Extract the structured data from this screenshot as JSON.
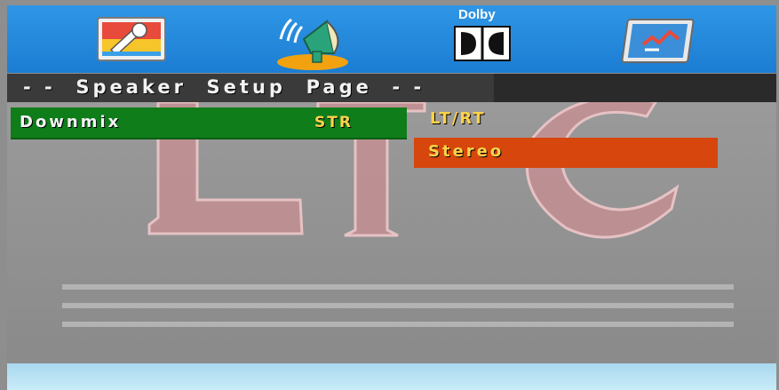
{
  "toolbar": {
    "icons": [
      {
        "name": "general-setup-icon"
      },
      {
        "name": "speaker-setup-icon"
      },
      {
        "name": "dolby-setup-icon",
        "label": "Dolby"
      },
      {
        "name": "preference-setup-icon"
      }
    ]
  },
  "page": {
    "title": "- -  Speaker  Setup  Page  - -"
  },
  "menu": {
    "items": [
      {
        "label": "Downmix",
        "value": "STR"
      }
    ]
  },
  "options": {
    "current": "LT/RT",
    "selected": "Stereo"
  },
  "watermark": {
    "text": "LTC"
  },
  "colors": {
    "top_bar": "#1c7dd2",
    "title_bar": "#3a3a3a",
    "menu_highlight": "#0f7d1a",
    "option_highlight": "#d6460d",
    "value_text": "#ffd24a"
  }
}
